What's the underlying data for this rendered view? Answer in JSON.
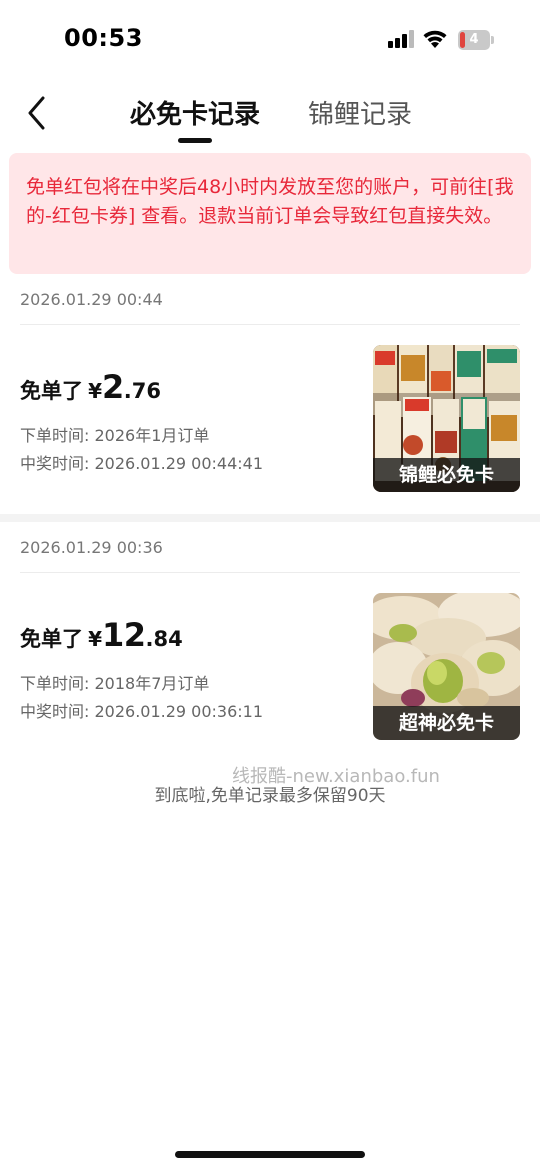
{
  "status_bar": {
    "time": "00:53",
    "battery_level": "4"
  },
  "nav": {
    "tabs": [
      {
        "label": "必免卡记录",
        "active": true
      },
      {
        "label": "锦鲤记录",
        "active": false
      }
    ]
  },
  "notice": {
    "text": "免单红包将在中奖后48小时内发放至您的账户，可前往[我的-红包卡券] 查看。退款当前订单会导致红包直接失效。",
    "color": "#e8283a",
    "background": "#ffe6e8"
  },
  "records": [
    {
      "date": "2026.01.29 00:44",
      "amount_label": "免单了",
      "currency": "¥",
      "amount_int": "2",
      "amount_dec": ".76",
      "order_time": "下单时间: 2026年1月订单",
      "win_time": "中奖时间: 2026.01.29 00:44:41",
      "badge": "锦鲤必免卡"
    },
    {
      "date": "2026.01.29 00:36",
      "amount_label": "免单了",
      "currency": "¥",
      "amount_int": "12",
      "amount_dec": ".84",
      "order_time": "下单时间: 2018年7月订单",
      "win_time": "中奖时间: 2026.01.29 00:36:11",
      "badge": "超神必免卡"
    }
  ],
  "watermark": "线报酷-new.xianbao.fun",
  "footer_note": "到底啦,免单记录最多保留90天"
}
